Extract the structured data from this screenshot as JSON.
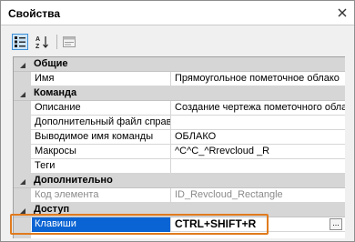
{
  "panel": {
    "title": "Свойства"
  },
  "toolbar": {
    "buttons": [
      {
        "icon": "categorized-view-icon",
        "active": true
      },
      {
        "icon": "alphabetical-sort-icon",
        "active": false
      },
      {
        "icon": "property-pages-icon",
        "active": false
      }
    ]
  },
  "grid": {
    "categories": {
      "general": "Общие",
      "command": "Команда",
      "advanced": "Дополнительно",
      "access": "Доступ"
    },
    "properties": {
      "name": {
        "label": "Имя",
        "value": "Прямоугольное пометочное облако"
      },
      "description": {
        "label": "Описание",
        "value": "Создание чертежа пометочного облака"
      },
      "help_file": {
        "label": "Дополнительный файл справки",
        "value": ""
      },
      "command_display": {
        "label": "Выводимое имя команды",
        "value": "ОБЛАКО"
      },
      "macro": {
        "label": "Макросы",
        "value": "^C^C_^Rrevcloud _R"
      },
      "tags": {
        "label": "Теги",
        "value": ""
      },
      "element_id": {
        "label": "Код элемента",
        "value": "ID_Revcloud_Rectangle"
      },
      "keys": {
        "label": "Клавиши",
        "value": "CTRL+SHIFT+R",
        "button": "..."
      }
    }
  }
}
